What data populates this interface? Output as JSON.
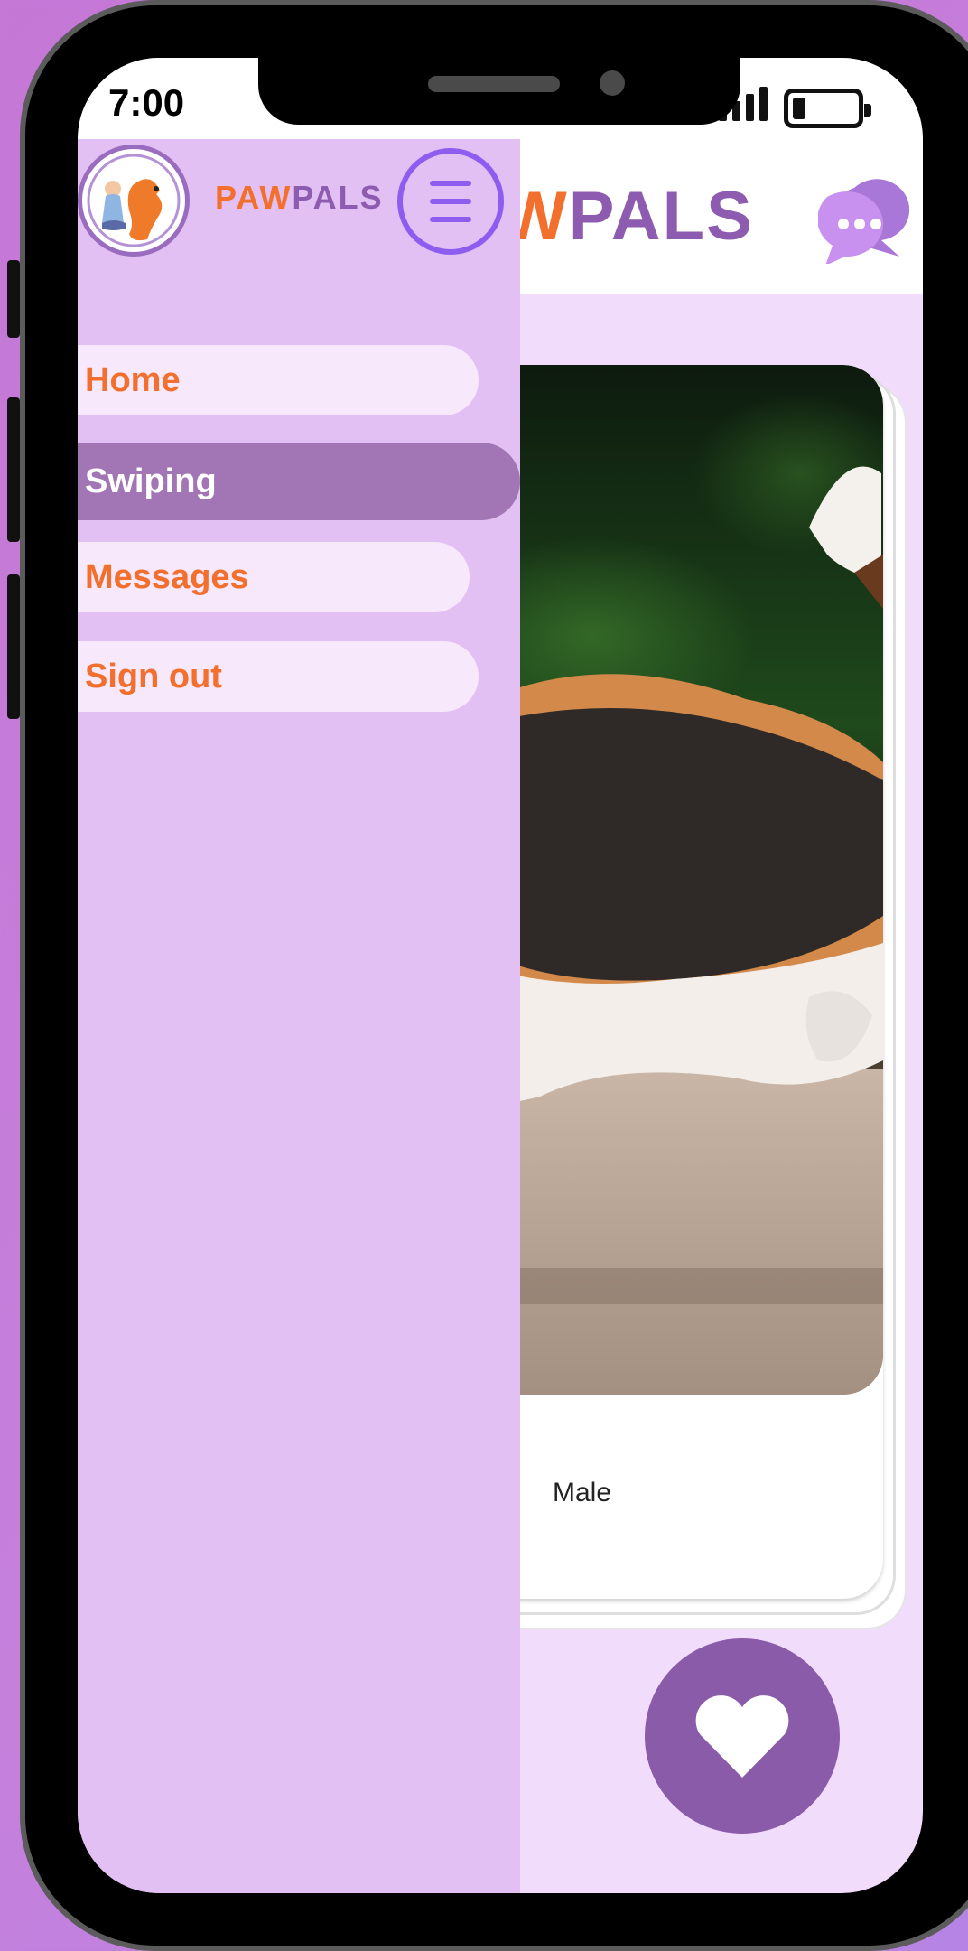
{
  "status_bar": {
    "time": "7:00"
  },
  "app": {
    "brand_prefix": "W",
    "brand_rest": "PALS",
    "drawer_brand_paw": "PAW",
    "drawer_brand_pals": "PALS"
  },
  "drawer": {
    "items": [
      {
        "label": "Home",
        "active": false
      },
      {
        "label": "Swiping",
        "active": true
      },
      {
        "label": "Messages",
        "active": false
      },
      {
        "label": "Sign out",
        "active": false
      }
    ]
  },
  "card": {
    "gender": "Male"
  },
  "icons": {
    "chat": "chat-bubbles-icon",
    "menu": "hamburger-menu-icon",
    "like": "heart-icon",
    "logo": "paw-pals-logo"
  },
  "colors": {
    "accent_purple": "#8a5ba8",
    "accent_orange": "#f26f2d",
    "drawer_bg": "#e2c0f4",
    "screen_bg": "#f1dcfc"
  }
}
